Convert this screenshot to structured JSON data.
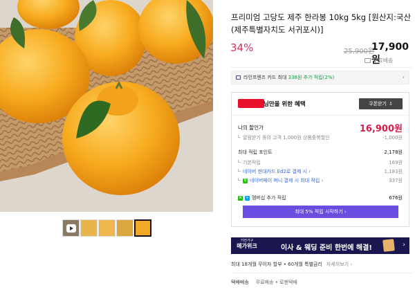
{
  "product": {
    "title": "프리미엄 고당도 제주 한라봉 10kg 5kg [원산지:국산(제주특별자치도 서귀포시)]",
    "discount": "34%",
    "original_price": "25,900원",
    "price": "17,900원",
    "shipping": "무료배송"
  },
  "card_banner": {
    "prefix": "라인프렌즈 카드 최대 ",
    "highlight": "338원 추가 적립(2%)",
    "chevron": "›"
  },
  "benefit": {
    "title": "님만을 위한 혜택",
    "coupon_button": "쿠폰받기",
    "my_price_label": "나의 할인가",
    "my_price": "16,900원",
    "coupon_note": "알림받기 동의 고객 1,000원 상품중복할인",
    "coupon_discount": "-1,000원",
    "max_points_label": "최대 적립 포인트",
    "max_points": "2,178원",
    "points": [
      {
        "label": "기본적립",
        "value": "169원"
      },
      {
        "label": "네이버 현대카드 Ed2로 결제 시 ›",
        "value": "1,183원"
      },
      {
        "label": "네이버페이 머니 결제 시 최대 적립 ›",
        "value": "337원"
      }
    ],
    "membership_label": "멤버십 추가 적립",
    "membership_value": "676원",
    "join_bar": "최대 5% 적립 시작하기 ›"
  },
  "ad": {
    "tag_top": "가전가구",
    "tag_main": "메가위크",
    "message": "이사 & 웨딩 준비 한번에 해결!",
    "chevron": "›"
  },
  "installment": {
    "text": "최대 18개월 무이자 할부 • 60개월 특별금리",
    "more": "자세히보기 ›"
  },
  "delivery": {
    "label": "택배배송",
    "value": "무료배송 • 로젠택배"
  },
  "icons": {
    "video_thumb": "play-icon",
    "shipping": "truck-icon",
    "card": "card-icon",
    "coupon": "download-icon"
  },
  "colors": {
    "discount": "#d6325f",
    "my_price": "#d61c4a",
    "accent_purple": "#6a4de0",
    "ad_bg": "#1a1650",
    "naver_green": "#1ec800"
  }
}
